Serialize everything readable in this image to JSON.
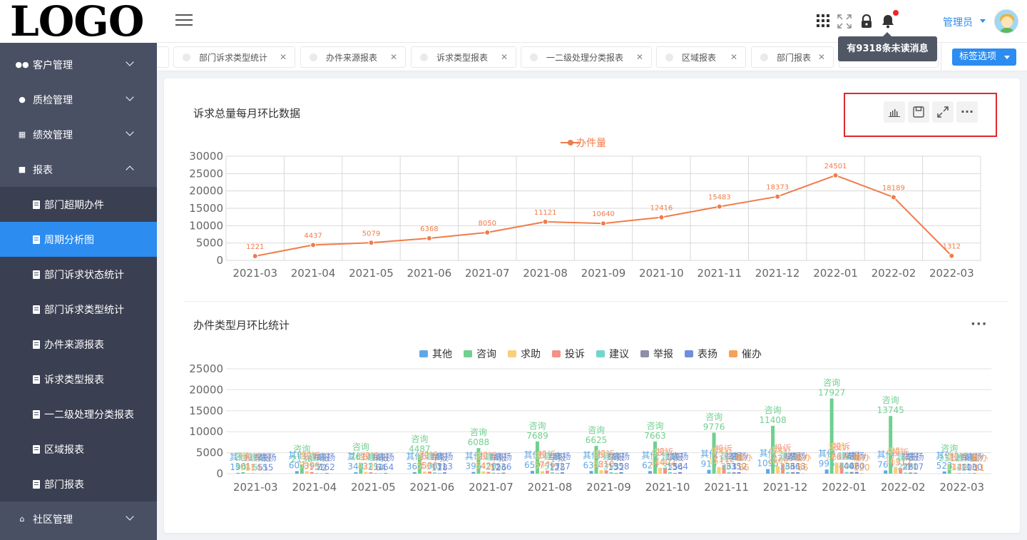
{
  "logo": "LOGO",
  "sidebar": {
    "items": [
      {
        "label": "客户管理"
      },
      {
        "label": "质检管理"
      },
      {
        "label": "绩效管理"
      },
      {
        "label": "报表"
      }
    ],
    "sub_items": [
      {
        "label": "部门超期办件"
      },
      {
        "label": "周期分析图"
      },
      {
        "label": "部门诉求状态统计"
      },
      {
        "label": "部门诉求类型统计"
      },
      {
        "label": "办件来源报表"
      },
      {
        "label": "诉求类型报表"
      },
      {
        "label": "一二级处理分类报表"
      },
      {
        "label": "区域报表"
      },
      {
        "label": "部门报表"
      }
    ],
    "bottom_item": {
      "label": "社区管理"
    }
  },
  "header": {
    "user": "管理员",
    "tooltip": "有9318条未读消息"
  },
  "tabs": [
    {
      "label": "部门诉求类型统计"
    },
    {
      "label": "办件来源报表"
    },
    {
      "label": "诉求类型报表"
    },
    {
      "label": "一二级处理分类报表"
    },
    {
      "label": "区域报表"
    },
    {
      "label": "部门报表"
    }
  ],
  "tab_options_label": "标签选项",
  "chart_data": [
    {
      "type": "line",
      "title": "诉求总量每月环比数据",
      "legend": [
        "办件量"
      ],
      "legend_position": "top-center",
      "color": "#f07c4a",
      "categories": [
        "2021-03",
        "2021-04",
        "2021-05",
        "2021-06",
        "2021-07",
        "2021-08",
        "2021-09",
        "2021-10",
        "2021-11",
        "2021-12",
        "2022-01",
        "2022-02",
        "2022-03"
      ],
      "series": [
        {
          "name": "办件量",
          "values": [
            1221,
            4437,
            5079,
            6368,
            8050,
            11121,
            10640,
            12416,
            15483,
            18373,
            24501,
            18189,
            1312
          ]
        }
      ],
      "ylim": [
        0,
        30000
      ],
      "yticks": [
        0,
        5000,
        10000,
        15000,
        20000,
        25000,
        30000
      ],
      "grid": true
    },
    {
      "type": "bar",
      "title": "办件类型月环比统计",
      "legend_position": "top-center",
      "categories": [
        "2021-03",
        "2021-04",
        "2021-05",
        "2021-06",
        "2021-07",
        "2021-08",
        "2021-09",
        "2021-10",
        "2021-11",
        "2021-12",
        "2022-01",
        "2022-02",
        "2022-03"
      ],
      "series": [
        {
          "name": "其他",
          "color": "#5fa8e8",
          "values": [
            190,
            603,
            343,
            363,
            395,
            659,
            634,
            625,
            915,
            1095,
            995,
            765,
            523
          ]
        },
        {
          "name": "咨询",
          "color": "#6fd08f",
          "values": [
            361,
            2138,
            2614,
            4487,
            6088,
            7689,
            6625,
            7663,
            9776,
            11408,
            17927,
            13745,
            2312
          ]
        },
        {
          "name": "求助",
          "color": "#f9cf7a",
          "values": [
            146,
            599,
            424,
            508,
            549,
            597,
            825,
            1402,
            1577,
            1800,
            2626,
            1607,
            142
          ]
        },
        {
          "name": "投诉",
          "color": "#f39186",
          "values": [
            114,
            395,
            321,
            508,
            420,
            746,
            810,
            1402,
            2112,
            2280,
            2626,
            1312,
            142
          ]
        },
        {
          "name": "建议",
          "color": "#72d6cc",
          "values": [
            55,
            152,
            154,
            302,
            235,
            327,
            353,
            355,
            363,
            361,
            406,
            248,
            102
          ]
        },
        {
          "name": "举报",
          "color": "#8e90a8",
          "values": [
            51,
            72,
            64,
            118,
            126,
            125,
            152,
            154,
            311,
            361,
            406,
            260,
            100
          ]
        },
        {
          "name": "表扬",
          "color": "#6d8fe0",
          "values": [
            55,
            162,
            164,
            313,
            236,
            327,
            358,
            364,
            352,
            363,
            420,
            217,
            130
          ]
        },
        {
          "name": "催办",
          "color": "#f4a25a",
          "values": [
            0,
            0,
            0,
            0,
            0,
            0,
            0,
            0,
            86,
            86,
            120,
            0,
            11
          ]
        }
      ],
      "ylim": [
        0,
        25000
      ],
      "yticks": [
        0,
        5000,
        10000,
        15000,
        20000,
        25000
      ],
      "grid": true
    }
  ]
}
